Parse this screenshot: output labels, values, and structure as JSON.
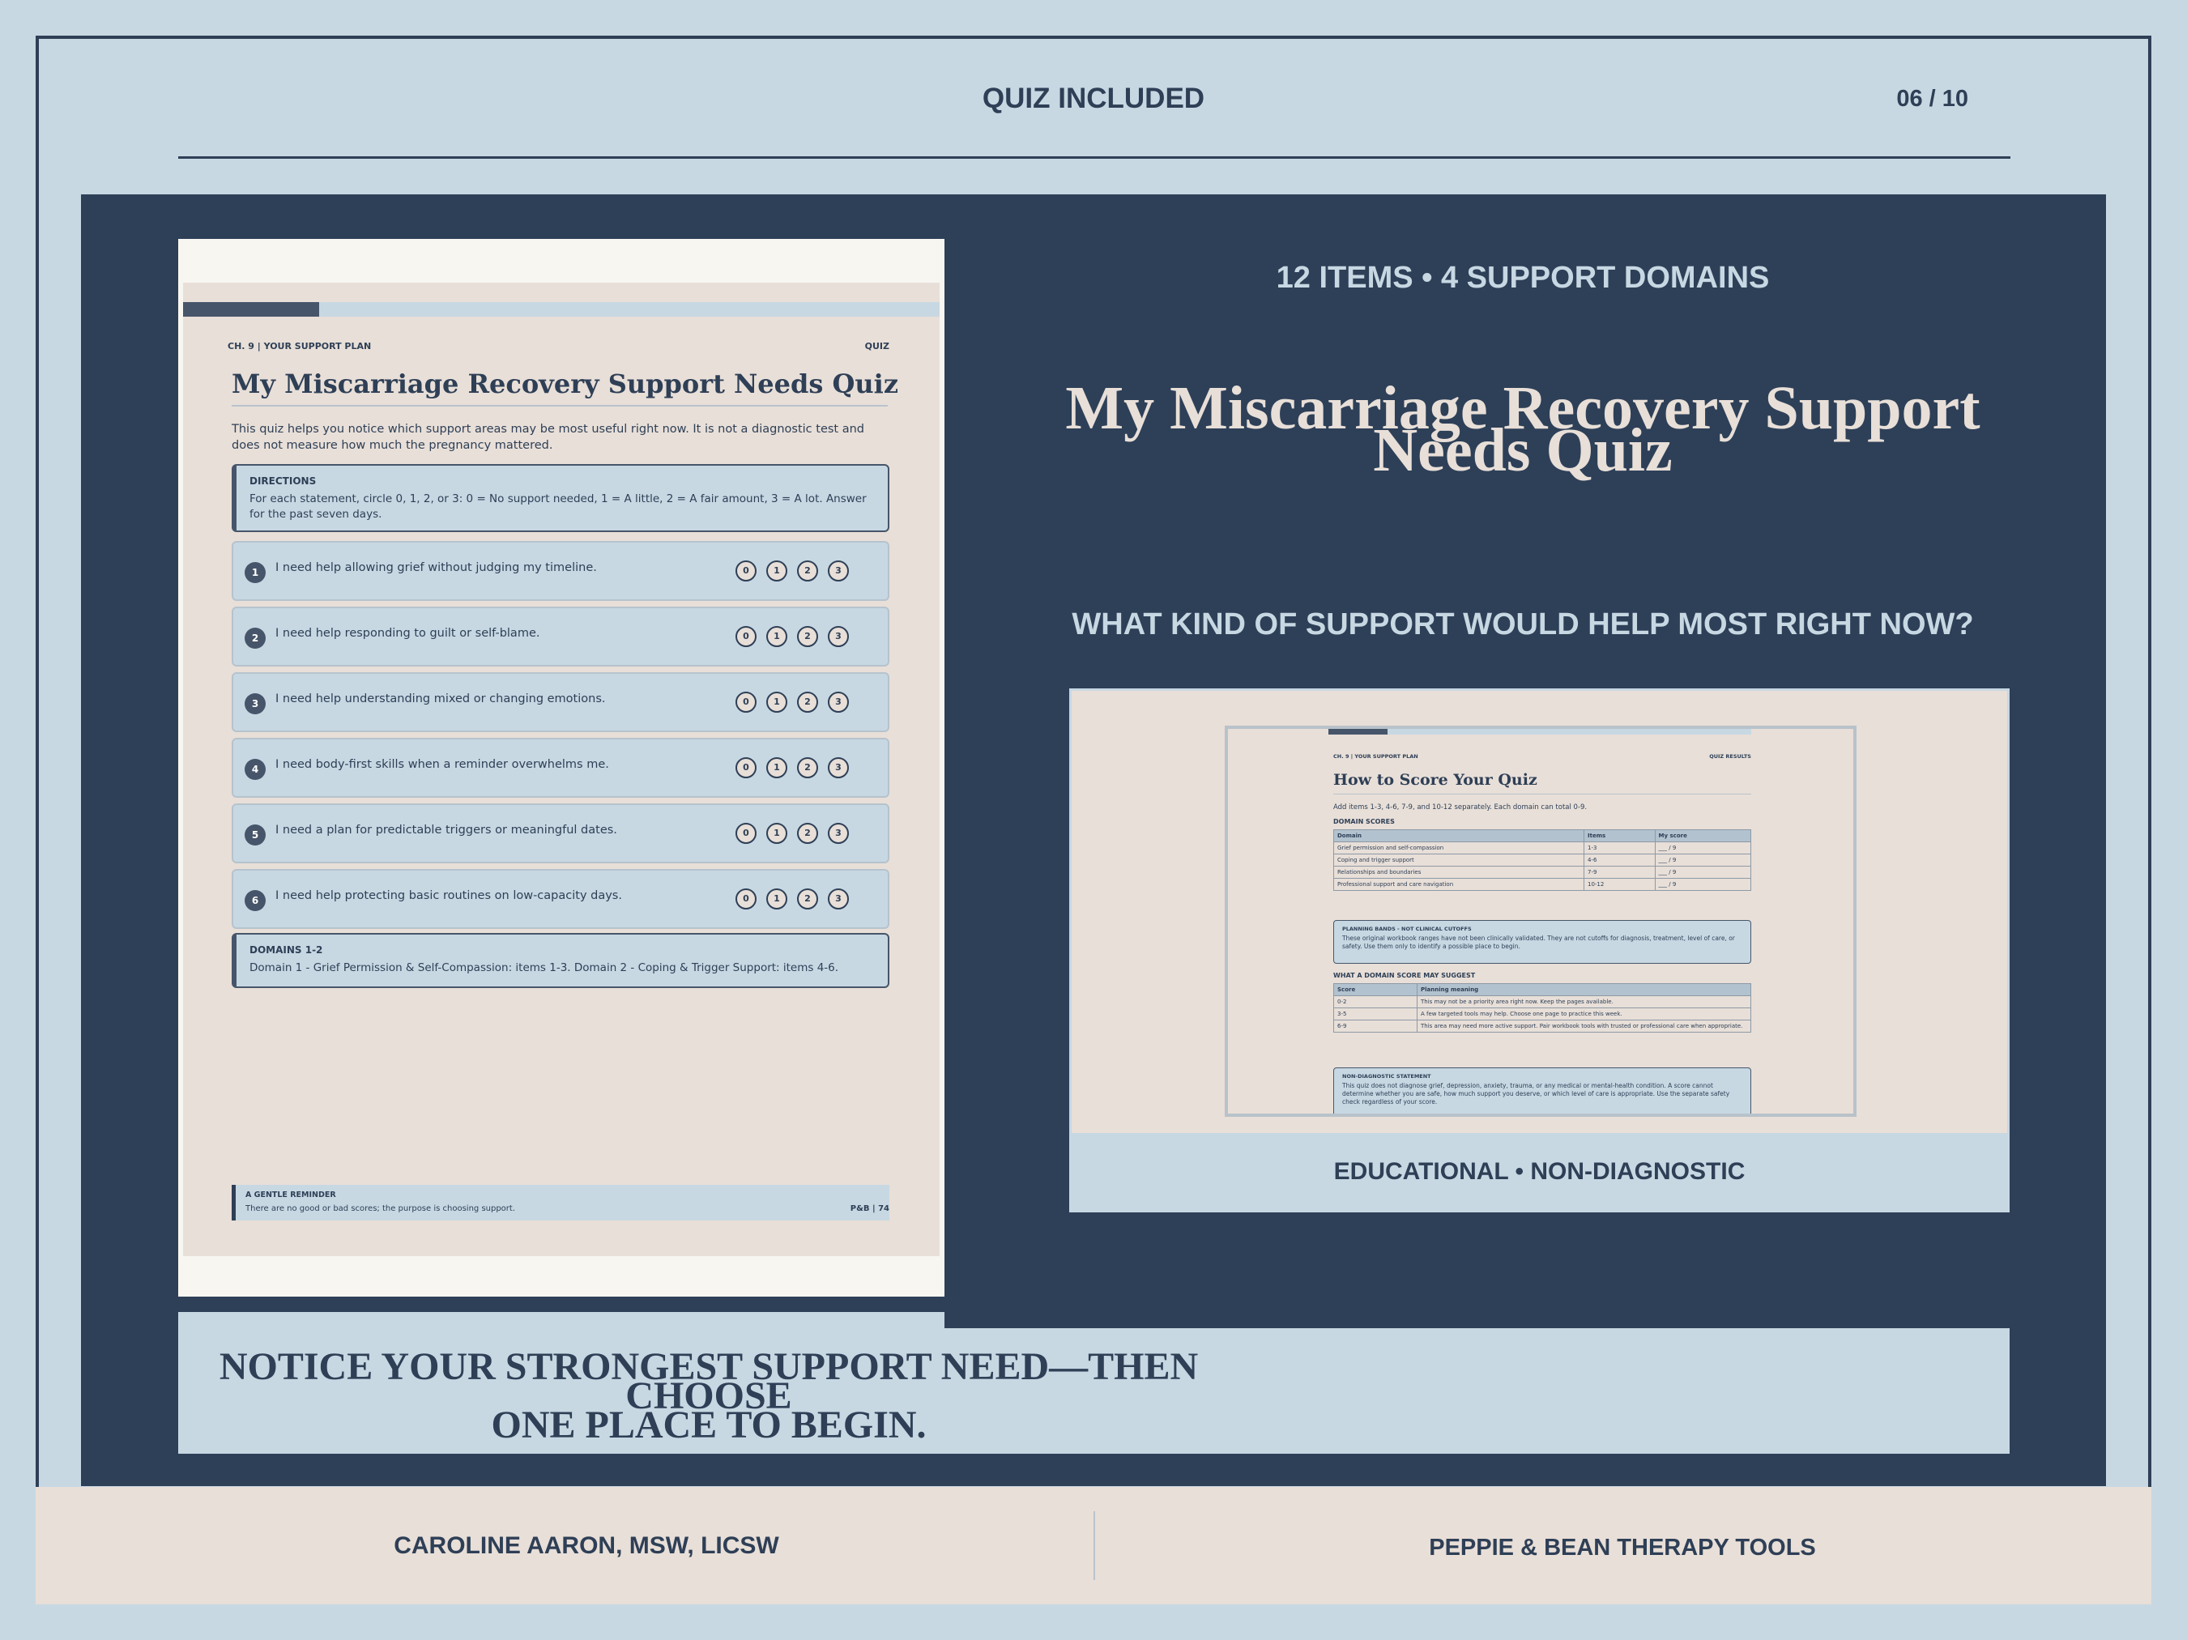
{
  "header": {
    "title": "QUIZ INCLUDED",
    "page_indicator": "06 / 10"
  },
  "quiz_page": {
    "progress": 0.18,
    "chapter": "CH. 9 | YOUR SUPPORT PLAN",
    "tag": "QUIZ",
    "title": "My Miscarriage Recovery Support Needs Quiz",
    "intro": "This quiz helps you notice which support areas may be most useful right now. It is not a diagnostic test and does not measure how much the pregnancy mattered.",
    "directions": {
      "title": "DIRECTIONS",
      "body": "For each statement, circle 0, 1, 2, or 3: 0 = No support needed, 1 = A little, 2 = A fair amount, 3 = A lot. Answer for the past seven days."
    },
    "options": [
      "0",
      "1",
      "2",
      "3"
    ],
    "items": [
      {
        "num": "1",
        "text": "I need help allowing grief without judging my timeline."
      },
      {
        "num": "2",
        "text": "I need help responding to guilt or self-blame."
      },
      {
        "num": "3",
        "text": "I need help understanding mixed or changing emotions."
      },
      {
        "num": "4",
        "text": "I need body-first skills when a reminder overwhelms me."
      },
      {
        "num": "5",
        "text": "I need a plan for predictable triggers or meaningful dates."
      },
      {
        "num": "6",
        "text": "I need help protecting basic routines on low-capacity days."
      }
    ],
    "domains": {
      "title": "DOMAINS 1-2",
      "body": "Domain 1 - Grief Permission & Self-Compassion: items 1-3. Domain 2 - Coping & Trigger Support: items 4-6."
    },
    "reminder": {
      "title": "A GENTLE REMINDER",
      "body": "There are no good or bad scores; the purpose is choosing support.",
      "page": "P&B | 74"
    }
  },
  "right": {
    "kicker": "12 ITEMS • 4 SUPPORT DOMAINS",
    "title_line1": "My Miscarriage Recovery Support",
    "title_line2": "Needs Quiz",
    "question": "WHAT KIND OF SUPPORT WOULD HELP MOST RIGHT NOW?",
    "preview_caption": "EDUCATIONAL • NON-DIAGNOSTIC"
  },
  "results_page": {
    "progress": 0.14,
    "chapter": "CH. 9 | YOUR SUPPORT PLAN",
    "tag": "QUIZ RESULTS",
    "title": "How to Score Your Quiz",
    "intro": "Add items 1-3, 4-6, 7-9, and 10-12 separately. Each domain can total 0-9.",
    "domain_heading": "DOMAIN SCORES",
    "domain_headers": [
      "Domain",
      "Items",
      "My score"
    ],
    "domain_rows": [
      [
        "Grief permission and self-compassion",
        "1-3",
        "___ / 9"
      ],
      [
        "Coping and trigger support",
        "4-6",
        "___ / 9"
      ],
      [
        "Relationships and boundaries",
        "7-9",
        "___ / 9"
      ],
      [
        "Professional support and care navigation",
        "10-12",
        "___ / 9"
      ]
    ],
    "bands": {
      "title": "PLANNING BANDS - NOT CLINICAL CUTOFFS",
      "body": "These original workbook ranges have not been clinically validated. They are not cutoffs for diagnosis, treatment, level of care, or safety. Use them only to identify a possible place to begin."
    },
    "suggest_heading": "WHAT A DOMAIN SCORE MAY SUGGEST",
    "score_headers": [
      "Score",
      "Planning meaning"
    ],
    "score_rows": [
      [
        "0-2",
        "This may not be a priority area right now. Keep the pages available."
      ],
      [
        "3-5",
        "A few targeted tools may help. Choose one page to practice this week."
      ],
      [
        "6-9",
        "This area may need more active support. Pair workbook tools with trusted or professional care when appropriate."
      ]
    ],
    "statement": {
      "title": "NON-DIAGNOSTIC STATEMENT",
      "body": "This quiz does not diagnose grief, depression, anxiety, trauma, or any medical or mental-health condition. A score cannot determine whether you are safe, how much support you deserve, or which level of care is appropriate. Use the separate safety check regardless of your score."
    }
  },
  "banner": {
    "line1": "NOTICE YOUR STRONGEST SUPPORT NEED—THEN CHOOSE",
    "line2": "ONE PLACE TO BEGIN."
  },
  "footer": {
    "author": "CAROLINE AARON, MSW, LICSW",
    "brand": "PEPPIE & BEAN THERAPY TOOLS"
  }
}
